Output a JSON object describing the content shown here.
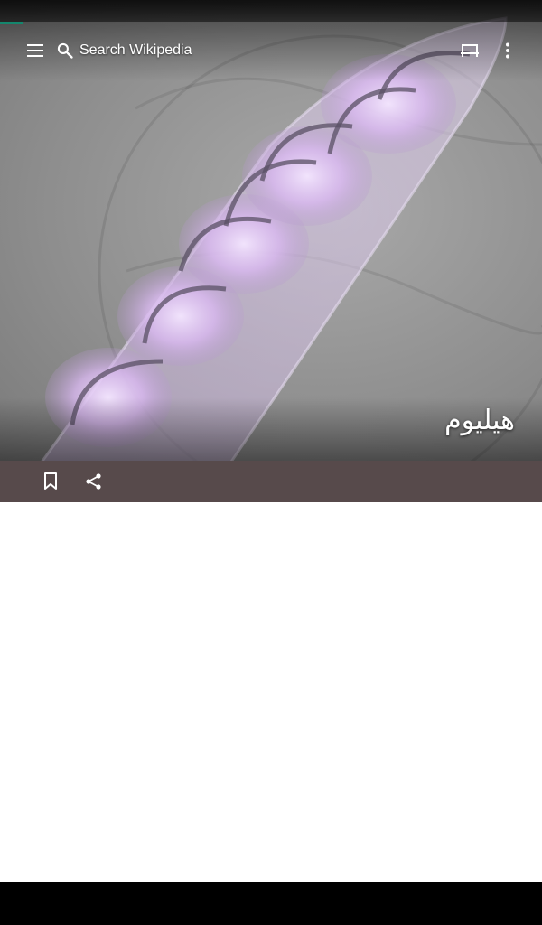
{
  "app": {
    "search_placeholder": "Search Wikipedia",
    "article_title": "هيليوم"
  },
  "icons": {
    "menu": "menu-icon",
    "search": "search-icon",
    "reading_list": "tabs-icon",
    "overflow": "more-vert-icon",
    "bookmark": "bookmark-icon",
    "share": "share-icon"
  },
  "colors": {
    "action_bar": "#574a4b",
    "progress": "#14866d",
    "background": "#ffffff",
    "navbar": "#000000"
  }
}
